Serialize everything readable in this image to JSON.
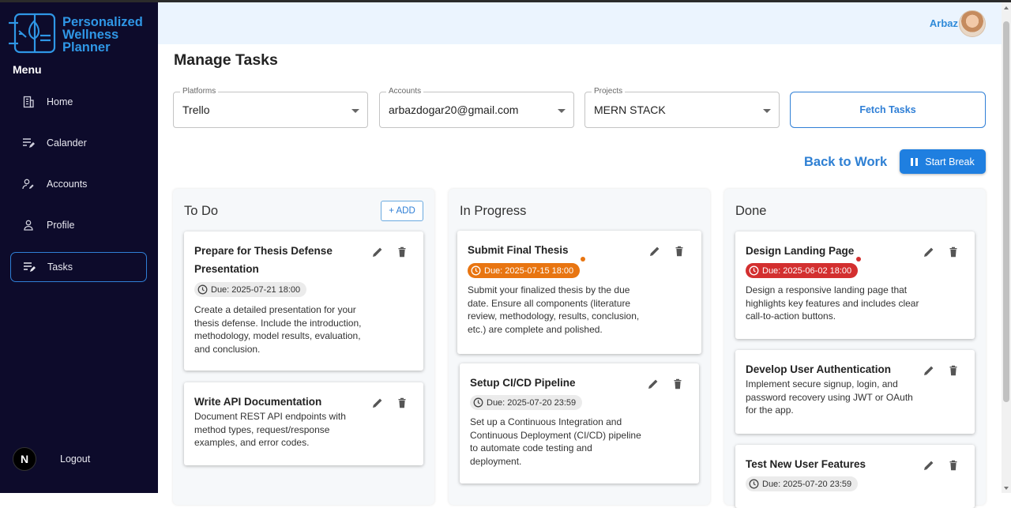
{
  "app": {
    "brand_lines": [
      "Personalized",
      "Wellness",
      "Planner"
    ],
    "menu_label": "Menu",
    "accent": "#2f97e6",
    "sidebar_bg": "#0d0b2b"
  },
  "sidebar": {
    "items": [
      {
        "label": "Home",
        "icon": "building-icon"
      },
      {
        "label": "Calander",
        "icon": "list-edit-icon"
      },
      {
        "label": "Accounts",
        "icon": "user-edit-icon"
      },
      {
        "label": "Profile",
        "icon": "user-icon"
      },
      {
        "label": "Tasks",
        "icon": "list-edit-icon",
        "active": true
      }
    ],
    "logout_label": "Logout",
    "logout_avatar": "N"
  },
  "header": {
    "username": "Arbaz"
  },
  "main": {
    "title": "Manage Tasks",
    "filters": [
      {
        "label": "Platforms",
        "value": "Trello"
      },
      {
        "label": "Accounts",
        "value": "arbazdogar20@gmail.com"
      },
      {
        "label": "Projects",
        "value": "MERN STACK"
      }
    ],
    "fetch_label": "Fetch Tasks",
    "status_text": "Back to Work",
    "break_label": "Start Break"
  },
  "board": {
    "add_label": "+ ADD",
    "columns": [
      {
        "title": "To Do",
        "cards": [
          {
            "title_lines": [
              "Prepare for Thesis Defense",
              "Presentation"
            ],
            "due": "Due: 2025-07-21 18:00",
            "due_status": "normal",
            "desc_lines": [
              "Create a detailed presentation for your",
              "thesis defense. Include the introduction,",
              "methodology, model results, evaluation,",
              "and conclusion."
            ]
          },
          {
            "title_lines": [
              "Write API Documentation"
            ],
            "desc_lines": [
              "Document REST API endpoints with",
              "method types, request/response",
              "examples, and error codes."
            ]
          }
        ]
      },
      {
        "title": "In Progress",
        "cards": [
          {
            "title_lines": [
              "Submit Final Thesis"
            ],
            "due": "Due: 2025-07-15 18:00",
            "due_status": "warning",
            "desc_lines": [
              "Submit your finalized thesis by the due",
              "date. Ensure all components (literature",
              "review, methodology, results, conclusion,",
              "etc.) are complete and polished."
            ]
          },
          {
            "title_lines": [
              "Setup CI/CD Pipeline"
            ],
            "due": "Due: 2025-07-20 23:59",
            "due_status": "normal",
            "desc_lines": [
              "Set up a Continuous Integration and",
              "Continuous Deployment (CI/CD) pipeline",
              "to automate code testing and",
              "deployment."
            ]
          }
        ]
      },
      {
        "title": "Done",
        "cards": [
          {
            "title_lines": [
              "Design Landing Page"
            ],
            "due": "Due: 2025-06-02 18:00",
            "due_status": "overdue",
            "desc_lines": [
              "Design a responsive landing page that",
              "highlights key features and includes clear",
              "call-to-action buttons."
            ]
          },
          {
            "title_lines": [
              "Develop User Authentication"
            ],
            "desc_lines": [
              "Implement secure signup, login, and",
              "password recovery using JWT or OAuth",
              "for the app."
            ]
          },
          {
            "title_lines": [
              "Test New User Features"
            ],
            "due": "Due: 2025-07-20 23:59",
            "due_status": "normal",
            "desc_lines": []
          }
        ]
      }
    ],
    "status_colors": {
      "warning": "#e87511",
      "overdue": "#d32f2f"
    }
  }
}
